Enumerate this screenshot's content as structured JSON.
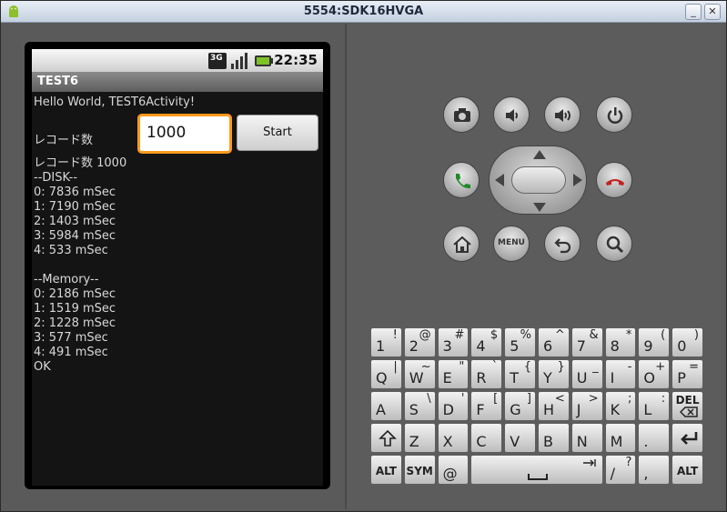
{
  "window": {
    "title": "5554:SDK16HVGA"
  },
  "status": {
    "time": "22:35",
    "network": "3G"
  },
  "app": {
    "title": "TEST6",
    "hello": "Hello World, TEST6Activity!",
    "record_label": "レコード数",
    "record_value": "1000",
    "start_label": "Start",
    "output": [
      "レコード数 1000",
      "--DISK--",
      "0: 7836 mSec",
      "1: 7190 mSec",
      "2: 1403 mSec",
      "3: 5984 mSec",
      "4: 533 mSec",
      "",
      "--Memory--",
      "0: 2186 mSec",
      "1: 1519 mSec",
      "2: 1228 mSec",
      "3: 577 mSec",
      "4: 491 mSec",
      "OK"
    ]
  },
  "hw_buttons": {
    "menu_label": "MENU"
  },
  "keyboard": {
    "row1": [
      [
        "1",
        "!"
      ],
      [
        "2",
        "@"
      ],
      [
        "3",
        "#"
      ],
      [
        "4",
        "$"
      ],
      [
        "5",
        "%"
      ],
      [
        "6",
        "^"
      ],
      [
        "7",
        "&"
      ],
      [
        "8",
        "*"
      ],
      [
        "9",
        "("
      ],
      [
        "0",
        ")"
      ]
    ],
    "row2": [
      [
        "Q",
        "|"
      ],
      [
        "W",
        "~"
      ],
      [
        "E",
        "\""
      ],
      [
        "R",
        "`"
      ],
      [
        "T",
        "{"
      ],
      [
        "Y",
        "}"
      ],
      [
        "U",
        "_"
      ],
      [
        "I",
        "-"
      ],
      [
        "O",
        "+"
      ],
      [
        "P",
        "="
      ]
    ],
    "row3": [
      [
        "A",
        ""
      ],
      [
        "S",
        "\\"
      ],
      [
        "D",
        "'"
      ],
      [
        "F",
        "["
      ],
      [
        "G",
        "]"
      ],
      [
        "H",
        "<"
      ],
      [
        "J",
        ">"
      ],
      [
        "K",
        ";"
      ],
      [
        "L",
        ":"
      ]
    ],
    "row4": [
      [
        "Z",
        ""
      ],
      [
        "X",
        ""
      ],
      [
        "C",
        ""
      ],
      [
        "V",
        ""
      ],
      [
        "B",
        ""
      ],
      [
        "N",
        ""
      ],
      [
        "M",
        ""
      ],
      [
        ".",
        ""
      ]
    ],
    "row5": {
      "alt": "ALT",
      "sym": "SYM",
      "at": "@",
      "slash": "/",
      "slash_shift": "?",
      "comma": ",",
      "alt2": "ALT"
    },
    "del_label": "DEL"
  }
}
